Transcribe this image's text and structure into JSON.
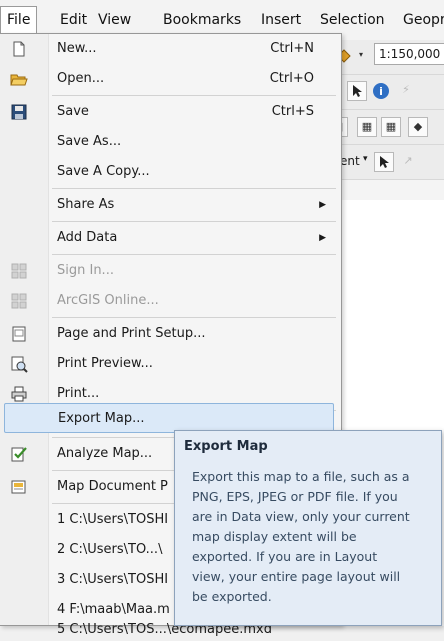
{
  "menubar": {
    "items": [
      "File",
      "Edit",
      "View",
      "Bookmarks",
      "Insert",
      "Selection",
      "Geopr"
    ]
  },
  "toolbar": {
    "scale_value": "1:150,000",
    "element_label": "ent"
  },
  "file_menu": {
    "new": {
      "label": "New...",
      "shortcut": "Ctrl+N",
      "icon": "new-document-icon"
    },
    "open": {
      "label": "Open...",
      "shortcut": "Ctrl+O",
      "icon": "open-folder-icon"
    },
    "save": {
      "label": "Save",
      "shortcut": "Ctrl+S",
      "icon": "floppy-disk-icon"
    },
    "save_as": {
      "label": "Save As..."
    },
    "save_copy": {
      "label": "Save A Copy..."
    },
    "share_as": {
      "label": "Share As"
    },
    "add_data": {
      "label": "Add Data"
    },
    "sign_in": {
      "label": "Sign In...",
      "icon": "grid-icon"
    },
    "arcgis_online": {
      "label": "ArcGIS Online...",
      "icon": "grid-icon"
    },
    "page_setup": {
      "label": "Page and Print Setup...",
      "icon": "page-setup-icon"
    },
    "print_preview": {
      "label": "Print Preview...",
      "icon": "print-preview-icon"
    },
    "print": {
      "label": "Print...",
      "icon": "printer-icon"
    },
    "export_map": {
      "label": "Export Map..."
    },
    "analyze_map": {
      "label": "Analyze Map...",
      "icon": "analyze-check-icon"
    },
    "map_doc_props": {
      "label": "Map Document P",
      "icon": "document-properties-icon"
    },
    "recent": [
      "1 C:\\Users\\TOSHI",
      "2 C:\\Users\\TO...\\",
      "3 C:\\Users\\TOSHI",
      "4 F:\\maab\\Maa.m",
      "5 C:\\Users\\TOS...\\ecomapee.mxd"
    ]
  },
  "tooltip": {
    "title": "Export Map",
    "lines": [
      "Export this map to a file, such as a",
      "PNG, EPS, JPEG or PDF file. If you",
      "are in Data view, only your current",
      "map display extent will be",
      "exported. If you are in Layout",
      "view, your entire page layout will",
      "be exported."
    ]
  },
  "colors": {
    "highlight_bg": "#dbe9f8",
    "highlight_border": "#8eb5dc",
    "tooltip_bg": "#e4ecf6",
    "disabled_text": "#9a9a9a"
  }
}
